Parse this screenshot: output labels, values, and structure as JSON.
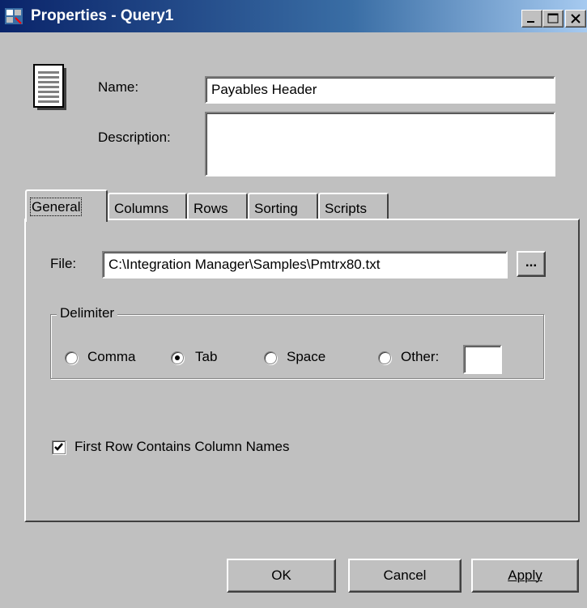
{
  "window": {
    "title": "Properties - Query1",
    "controls": [
      "minimize-icon",
      "maximize-icon",
      "close-icon"
    ]
  },
  "header": {
    "name_label": "Name:",
    "name_value": "Payables Header",
    "description_label": "Description:",
    "description_value": ""
  },
  "tabs": [
    {
      "label": "General",
      "active": true
    },
    {
      "label": "Columns",
      "active": false
    },
    {
      "label": "Rows",
      "active": false
    },
    {
      "label": "Sorting",
      "active": false
    },
    {
      "label": "Scripts",
      "active": false
    }
  ],
  "general": {
    "file_label": "File:",
    "file_value": "C:\\Integration Manager\\Samples\\Pmtrx80.txt",
    "browse_label": "...",
    "delimiter": {
      "legend": "Delimiter",
      "options": [
        {
          "label": "Comma",
          "selected": false
        },
        {
          "label": "Tab",
          "selected": true
        },
        {
          "label": "Space",
          "selected": false
        },
        {
          "label": "Other:",
          "selected": false
        }
      ],
      "other_value": ""
    },
    "first_row_label": "First Row Contains Column Names",
    "first_row_checked": true
  },
  "buttons": {
    "ok": "OK",
    "cancel": "Cancel",
    "apply": "Apply"
  },
  "colors": {
    "title_gradient_start": "#0a246a",
    "title_gradient_end": "#a6caf0",
    "face": "#c0c0c0"
  }
}
